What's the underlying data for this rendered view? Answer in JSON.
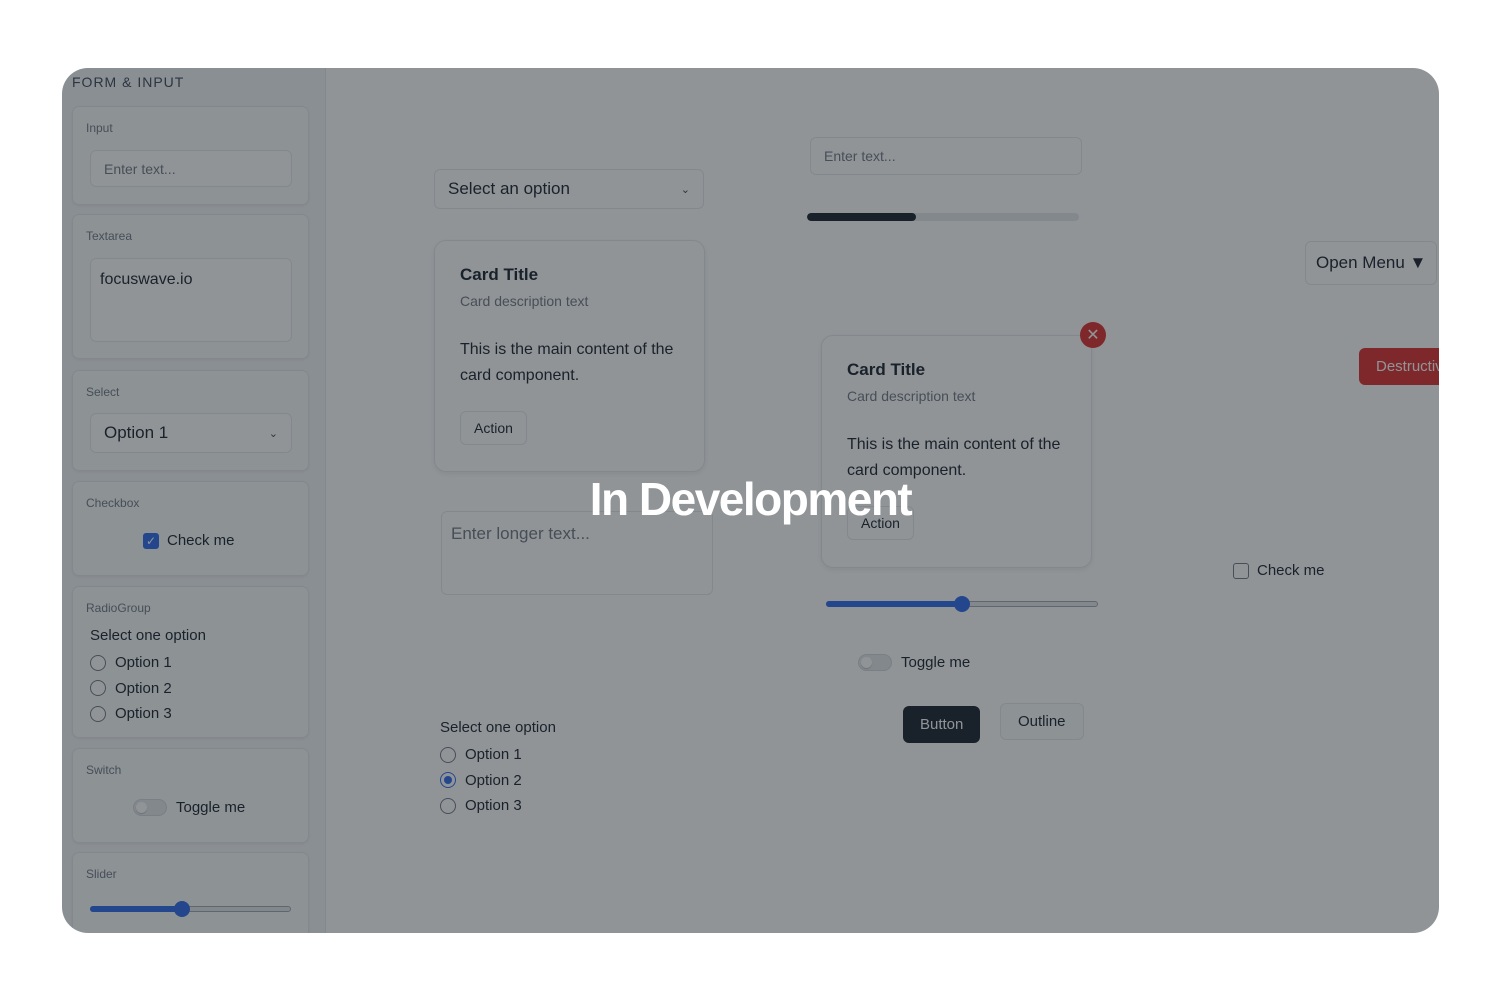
{
  "sidebar": {
    "title": "FORM & INPUT",
    "input": {
      "label": "Input",
      "placeholder": "Enter text..."
    },
    "textarea": {
      "label": "Textarea",
      "value": "focuswave.io"
    },
    "select": {
      "label": "Select",
      "value": "Option 1"
    },
    "checkbox": {
      "label": "Checkbox",
      "text": "Check me",
      "checked": true
    },
    "radio": {
      "label": "RadioGroup",
      "title": "Select one option",
      "options": [
        "Option 1",
        "Option 2",
        "Option 3"
      ]
    },
    "switch": {
      "label": "Switch",
      "text": "Toggle me"
    },
    "slider": {
      "label": "Slider",
      "value": 0.46
    }
  },
  "main": {
    "select": {
      "value": "Select an option"
    },
    "input": {
      "placeholder": "Enter text..."
    },
    "progress": {
      "value": 0.4
    },
    "card1": {
      "title": "Card Title",
      "desc": "Card description text",
      "body": "This is the main content of the card component.",
      "action": "Action"
    },
    "card2": {
      "title": "Card Title",
      "desc": "Card description text",
      "body": "This is the main content of the card component.",
      "action": "Action"
    },
    "menu_button": "Open Menu ▼",
    "destructive_button": "Destructive",
    "textarea": {
      "placeholder": "Enter longer text..."
    },
    "checkbox": {
      "text": "Check me"
    },
    "slider": {
      "value": 0.5
    },
    "switch": {
      "text": "Toggle me"
    },
    "button": "Button",
    "outline_button": "Outline",
    "radio": {
      "title": "Select one option",
      "options": [
        "Option 1",
        "Option 2",
        "Option 3"
      ],
      "selected": "Option 2"
    }
  },
  "overlay": {
    "text": "In Development"
  },
  "colors": {
    "accent": "#2563eb",
    "destructive": "#dc2626",
    "dark": "#111827"
  },
  "icons": {
    "chevron": "chevron-down-icon",
    "close": "close-icon",
    "check": "check-icon"
  }
}
